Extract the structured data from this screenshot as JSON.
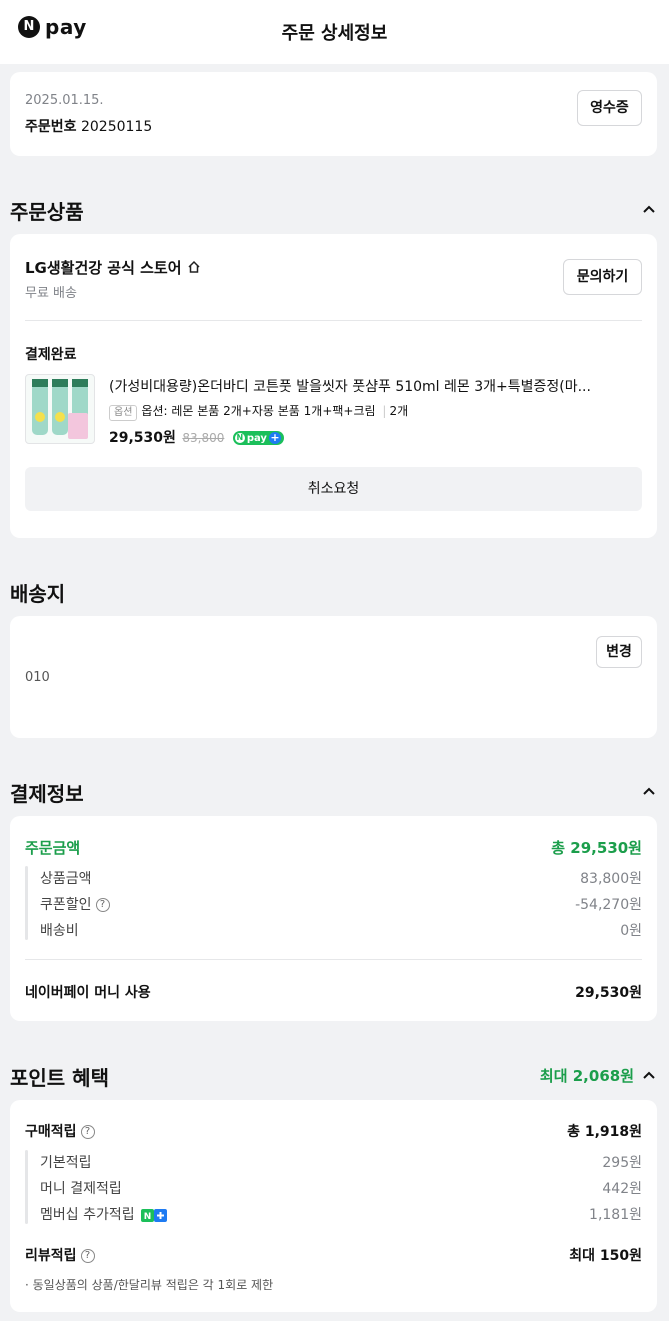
{
  "header": {
    "brand_n": "N",
    "brand_text": "pay",
    "title": "주문 상세정보"
  },
  "order_info": {
    "date": "2025.01.15.",
    "order_no_label": "주문번호",
    "order_no": "20250115",
    "receipt_label": "영수증"
  },
  "products_section": {
    "title": "주문상품",
    "store_name": "LG생활건강 공식 스토어",
    "shipping": "무료 배송",
    "inquiry_label": "문의하기",
    "status": "결제완료",
    "product_name": "(가성비대용량)온더바디 코튼풋 발을씻자 풋샴푸 510ml 레몬 3개+특별증정(마...",
    "option_tag": "옵션",
    "option_text": "옵션: 레몬 본품 2개+자몽 본품 1개+팩+크림",
    "quantity": "2개",
    "price": "29,530원",
    "original_price": "83,800",
    "npay_badge": "pay",
    "cancel_label": "취소요청"
  },
  "delivery_section": {
    "title": "배송지",
    "change_label": "변경",
    "phone": "010"
  },
  "payment_section": {
    "title": "결제정보",
    "order_amount_label": "주문금액",
    "order_amount_value": "총 29,530원",
    "rows": [
      {
        "label": "상품금액",
        "value": "83,800원"
      },
      {
        "label": "쿠폰할인",
        "value": "-54,270원"
      },
      {
        "label": "배송비",
        "value": "0원"
      }
    ],
    "money_label": "네이버페이 머니 사용",
    "money_value": "29,530원"
  },
  "points_section": {
    "title": "포인트 혜택",
    "max_label": "최대 2,068원",
    "purchase_label": "구매적립",
    "purchase_value": "총 1,918원",
    "rows": [
      {
        "label": "기본적립",
        "value": "295원"
      },
      {
        "label": "머니 결제적립",
        "value": "442원"
      },
      {
        "label": "멤버십 추가적립",
        "value": "1,181원"
      }
    ],
    "review_label": "리뷰적립",
    "review_value": "최대 150원",
    "note": "· 동일상품의 상품/한달리뷰 적립은 각 1회로 제한"
  },
  "colors": {
    "accent_green": "#1b9e4b",
    "background": "#f1f2f4"
  }
}
